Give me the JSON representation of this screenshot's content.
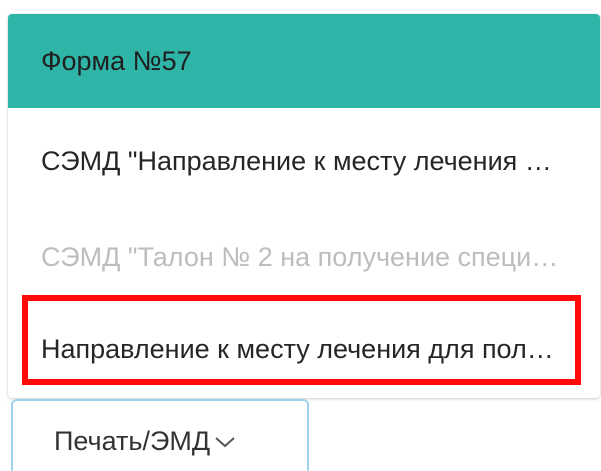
{
  "menu": {
    "items": [
      {
        "label": "Форма №57",
        "state": "active"
      },
      {
        "label": "СЭМД \"Направление к месту лечения …",
        "state": "enabled"
      },
      {
        "label": "СЭМД \"Талон № 2 на получение специ…",
        "state": "disabled"
      },
      {
        "label": "Направление к месту лечения для пол…",
        "state": "highlighted"
      }
    ]
  },
  "print_button": {
    "label": "Печать/ЭМД",
    "icon": "chevron-down-icon"
  },
  "colors": {
    "active_item_bg": "#2fb5a8",
    "highlight_border": "#ff0a0a",
    "button_border": "#9fd2ee",
    "disabled_text": "#bdbdbd"
  }
}
